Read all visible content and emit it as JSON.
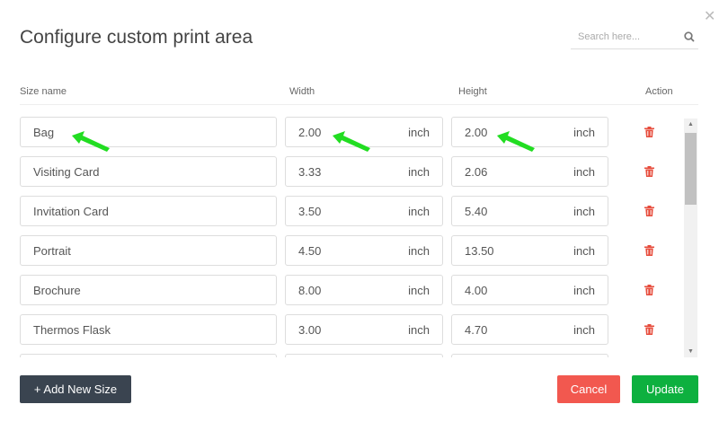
{
  "dialog": {
    "title": "Configure custom print area",
    "close_icon": "close-icon"
  },
  "search": {
    "placeholder": "Search here...",
    "icon": "search-icon"
  },
  "columns": [
    "Size name",
    "Width",
    "Height",
    "Action"
  ],
  "rows": [
    {
      "name": "Bag",
      "width": "2.00",
      "height": "2.00",
      "unit": "inch"
    },
    {
      "name": "Visiting Card",
      "width": "3.33",
      "height": "2.06",
      "unit": "inch"
    },
    {
      "name": "Invitation Card",
      "width": "3.50",
      "height": "5.40",
      "unit": "inch"
    },
    {
      "name": "Portrait",
      "width": "4.50",
      "height": "13.50",
      "unit": "inch"
    },
    {
      "name": "Brochure",
      "width": "8.00",
      "height": "4.00",
      "unit": "inch"
    },
    {
      "name": "Thermos Flask",
      "width": "3.00",
      "height": "4.70",
      "unit": "inch"
    },
    {
      "name": "",
      "width": "",
      "height": "",
      "unit": ""
    }
  ],
  "footer": {
    "add_label": "+ Add New Size",
    "cancel_label": "Cancel",
    "update_label": "Update"
  },
  "colors": {
    "delete": "#e74c3c",
    "cancel": "#f2584f",
    "update": "#0db03f",
    "add": "#3a4450",
    "annotation_arrow": "#22dd22"
  }
}
